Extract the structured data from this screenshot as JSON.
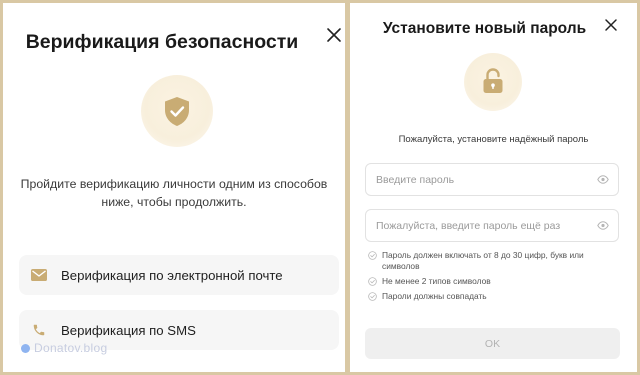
{
  "colors": {
    "accent": "#c9ac74",
    "frame": "#d9c8a4",
    "option_bg": "#f6f6f6",
    "disabled_button": "#efefef"
  },
  "verification": {
    "title": "Верификация безопасности",
    "close_icon": "close-icon",
    "shield_icon": "shield-check-icon",
    "description": "Пройдите верификацию личности одним из способов ниже, чтобы продолжить.",
    "options": [
      {
        "icon": "mail-icon",
        "label": "Верификация по электронной почте"
      },
      {
        "icon": "phone-icon",
        "label": "Верификация по SMS"
      }
    ],
    "watermark": "Donatov.blog"
  },
  "new_password": {
    "title": "Установите новый пароль",
    "close_icon": "close-icon",
    "lock_icon": "lock-open-icon",
    "description": "Пожалуйста, установите надёжный пароль",
    "password_placeholder": "Введите пароль",
    "password_value": "",
    "confirm_placeholder": "Пожалуйста, введите пароль ещё раз",
    "confirm_value": "",
    "rules": [
      "Пароль должен включать от 8 до 30 цифр, букв или символов",
      "Не менее 2 типов символов",
      "Пароли должны совпадать"
    ],
    "ok_label": "OK"
  }
}
